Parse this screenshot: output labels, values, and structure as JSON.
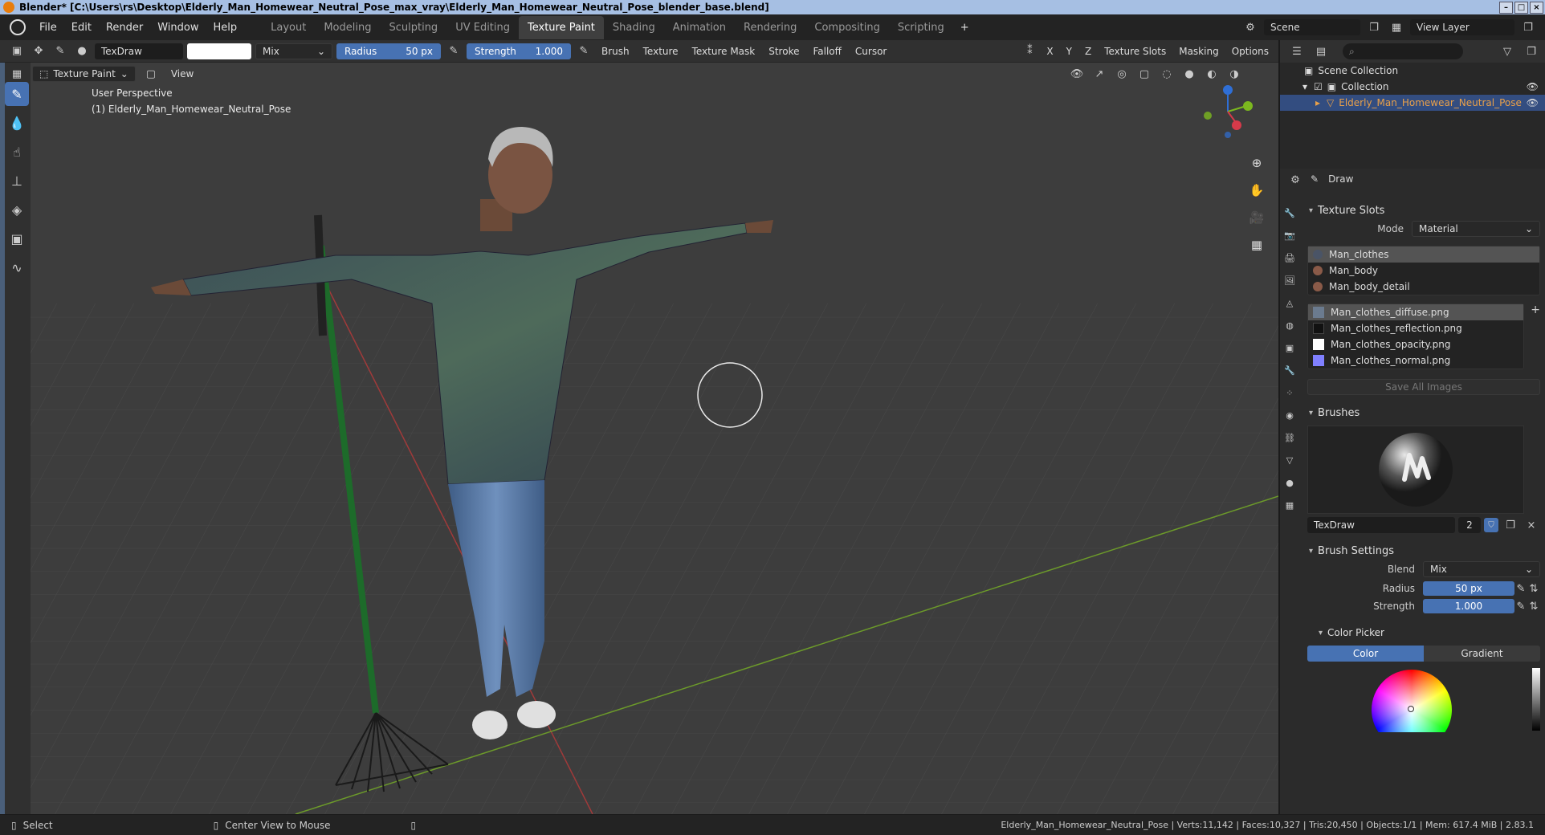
{
  "window": {
    "title": "Blender* [C:\\Users\\rs\\Desktop\\Elderly_Man_Homewear_Neutral_Pose_max_vray\\Elderly_Man_Homewear_Neutral_Pose_blender_base.blend]"
  },
  "menu": [
    "File",
    "Edit",
    "Render",
    "Window",
    "Help"
  ],
  "workspaces": [
    {
      "label": "Layout",
      "active": false
    },
    {
      "label": "Modeling",
      "active": false
    },
    {
      "label": "Sculpting",
      "active": false
    },
    {
      "label": "UV Editing",
      "active": false
    },
    {
      "label": "Texture Paint",
      "active": true
    },
    {
      "label": "Shading",
      "active": false
    },
    {
      "label": "Animation",
      "active": false
    },
    {
      "label": "Rendering",
      "active": false
    },
    {
      "label": "Compositing",
      "active": false
    },
    {
      "label": "Scripting",
      "active": false
    }
  ],
  "scene": {
    "name": "Scene",
    "view_layer": "View Layer"
  },
  "header": {
    "brush_name": "TexDraw",
    "blend_mode": "Mix",
    "radius_label": "Radius",
    "radius_value": "50 px",
    "strength_label": "Strength",
    "strength_value": "1.000",
    "menus": [
      "Brush",
      "Texture",
      "Texture Mask",
      "Stroke",
      "Falloff",
      "Cursor"
    ],
    "axes": [
      "X",
      "Y",
      "Z"
    ],
    "right_menus": [
      "Texture Slots",
      "Masking",
      "Options"
    ]
  },
  "header2": {
    "mode": "Texture Paint",
    "view": "View"
  },
  "viewport": {
    "perspective": "User Perspective",
    "object_label": "(1) Elderly_Man_Homewear_Neutral_Pose"
  },
  "outliner": {
    "scene_collection": "Scene Collection",
    "collection": "Collection",
    "object": "Elderly_Man_Homewear_Neutral_Pose"
  },
  "props": {
    "tool_name": "Draw",
    "texture_slots_title": "Texture Slots",
    "mode_label": "Mode",
    "mode_value": "Material",
    "materials": [
      "Man_clothes",
      "Man_body",
      "Man_body_detail"
    ],
    "images": [
      {
        "name": "Man_clothes_diffuse.png",
        "color": "#6b7b8f"
      },
      {
        "name": "Man_clothes_reflection.png",
        "color": "#111111"
      },
      {
        "name": "Man_clothes_opacity.png",
        "color": "#ffffff"
      },
      {
        "name": "Man_clothes_normal.png",
        "color": "#8080ff"
      }
    ],
    "save_all": "Save All Images",
    "brushes_title": "Brushes",
    "brush_name": "TexDraw",
    "brush_users": "2",
    "brush_settings_title": "Brush Settings",
    "blend_label": "Blend",
    "blend_value": "Mix",
    "radius_label": "Radius",
    "radius_value": "50 px",
    "strength_label": "Strength",
    "strength_value": "1.000",
    "color_picker_title": "Color Picker",
    "color_tab": "Color",
    "gradient_tab": "Gradient"
  },
  "status": {
    "select": "Select",
    "center_view": "Center View to Mouse",
    "stats": "Elderly_Man_Homewear_Neutral_Pose | Verts:11,142 | Faces:10,327 | Tris:20,450 | Objects:1/1 | Mem: 617.4 MiB | 2.83.1"
  },
  "colors": {
    "accent": "#4772b3",
    "viewport_bg": "#3d3d3d",
    "selection_text": "#e8a04a"
  }
}
